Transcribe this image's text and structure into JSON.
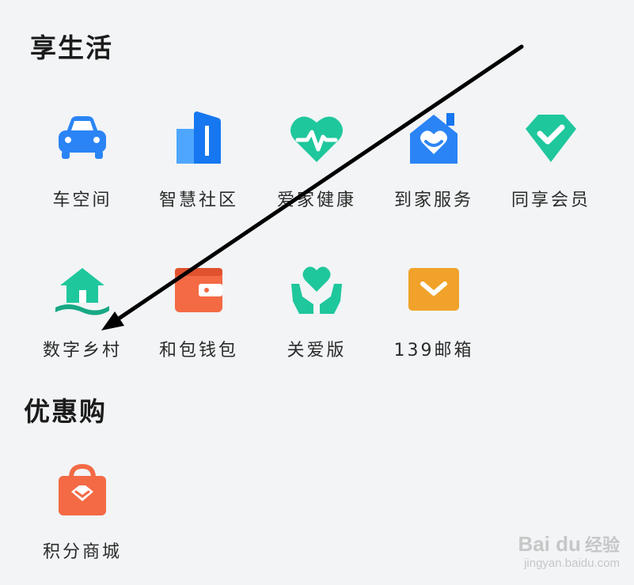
{
  "sections": {
    "life": {
      "title": "享生活",
      "apps": [
        {
          "label": "车空间",
          "icon": "car-icon"
        },
        {
          "label": "智慧社区",
          "icon": "building-icon"
        },
        {
          "label": "爱家健康",
          "icon": "heart-pulse-icon"
        },
        {
          "label": "到家服务",
          "icon": "home-heart-icon"
        },
        {
          "label": "同享会员",
          "icon": "diamond-check-icon"
        },
        {
          "label": "数字乡村",
          "icon": "village-house-icon"
        },
        {
          "label": "和包钱包",
          "icon": "wallet-icon"
        },
        {
          "label": "关爱版",
          "icon": "hands-heart-icon"
        },
        {
          "label": "139邮箱",
          "icon": "mail-icon"
        }
      ]
    },
    "deals": {
      "title": "优惠购",
      "apps": [
        {
          "label": "积分商城",
          "icon": "shopping-bag-icon"
        }
      ]
    }
  },
  "watermark": {
    "logo": "Bai du",
    "text": "经验",
    "url": "jingyan.baidu.com"
  },
  "colors": {
    "background": "#f2f4f6",
    "blue": "#2a84f5",
    "teal": "#1fc79c",
    "orange": "#f0a22a",
    "red": "#f36a45",
    "arrow": "#000000"
  }
}
